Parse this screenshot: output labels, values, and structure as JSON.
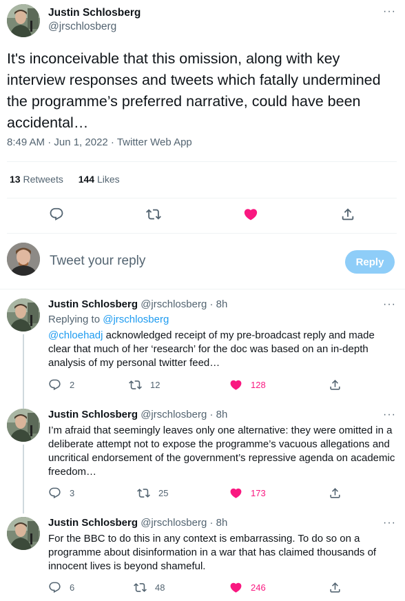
{
  "main_tweet": {
    "author_name": "Justin Schlosberg",
    "author_handle": "@jrschlosberg",
    "text": "It's inconceivable that this omission, along with key interview responses and tweets which fatally undermined the programme’s preferred narrative, could have been accidental…",
    "meta": "8:49 AM · Jun 1, 2022 · Twitter Web App",
    "retweets_count": "13",
    "retweets_label": "Retweets",
    "likes_count": "144",
    "likes_label": "Likes",
    "more_label": "···"
  },
  "reply_box": {
    "placeholder": "Tweet your reply",
    "button_label": "Reply"
  },
  "replies": [
    {
      "author_name": "Justin Schlosberg",
      "author_handle": "@jrschlosberg",
      "time": "· 8h",
      "replying_prefix": "Replying to",
      "replying_handle": "@jrschlosberg",
      "mention": "@chloehadj",
      "text": " acknowledged receipt of my pre-broadcast reply and made clear that much of her ‘research’ for the doc was based on an in-depth analysis of my personal twitter feed…",
      "replies": "2",
      "retweets": "12",
      "likes": "128"
    },
    {
      "author_name": "Justin Schlosberg",
      "author_handle": "@jrschlosberg",
      "time": "· 8h",
      "text": "I’m afraid that seemingly leaves only one alternative: they were omitted in a deliberate attempt not to expose the programme’s vacuous allegations and uncritical endorsement of the government’s repressive agenda on academic freedom…",
      "replies": "3",
      "retweets": "25",
      "likes": "173"
    },
    {
      "author_name": "Justin Schlosberg",
      "author_handle": "@jrschlosberg",
      "time": "· 8h",
      "text": "For the BBC to do this in any context is embarrassing. To do so on a programme about disinformation in a war that has claimed thousands of innocent lives is beyond shameful.",
      "replies": "6",
      "retweets": "48",
      "likes": "246"
    }
  ],
  "colors": {
    "like_pink": "#f91880",
    "link_blue": "#1d9bf0",
    "reply_button_disabled": "#8ecdf8",
    "muted_text": "#536471"
  },
  "icons": [
    "reply-icon",
    "retweet-icon",
    "like-filled-icon",
    "share-icon",
    "more-icon"
  ]
}
